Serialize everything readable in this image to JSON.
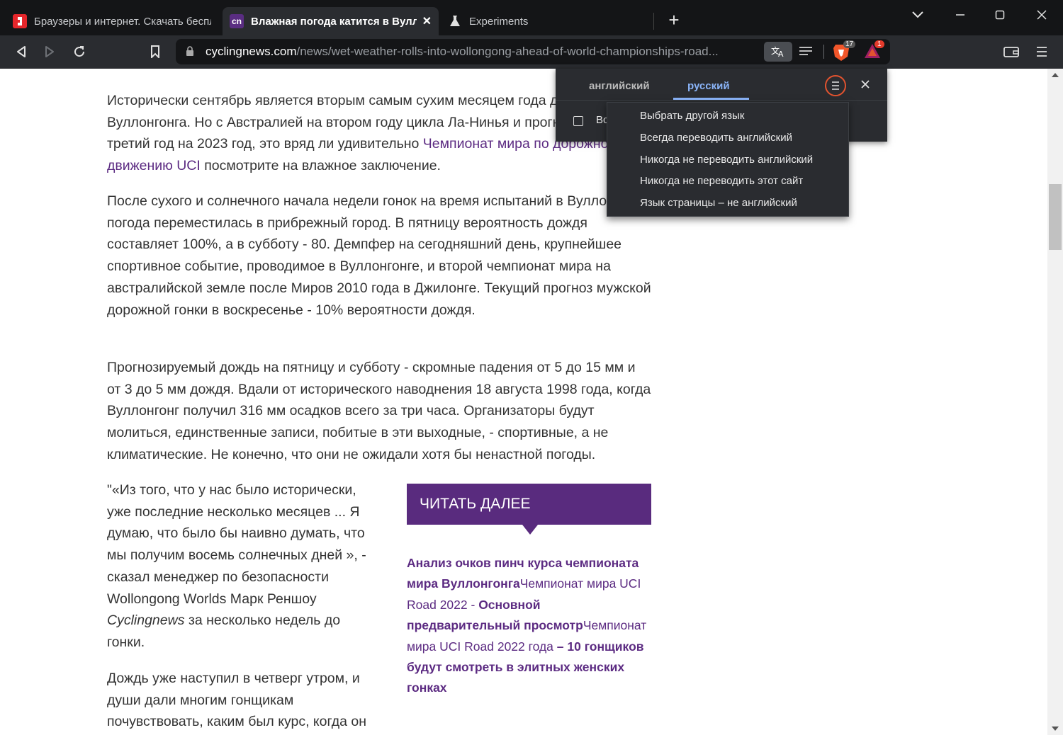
{
  "tabs": [
    {
      "title": "Браузеры и интернет. Скачать беспл",
      "favicon": "red-square-icon"
    },
    {
      "title": "Влажная погода катится в Вуллонгонг",
      "favicon": "cn"
    },
    {
      "title": "Experiments",
      "favicon": "flask-icon"
    }
  ],
  "address_bar": {
    "host": "cyclingnews.com",
    "path": "/news/wet-weather-rolls-into-wollongong-ahead-of-world-championships-road..."
  },
  "badges": {
    "brave_shields": "17",
    "rewards": "1"
  },
  "article": {
    "p1": {
      "text": "Исторически сентябрь является вторым самым сухим месяцем года для Вуллонгонга. Но с Австралией на втором году цикла Ла-Нинья и прогнозом на третий год на 2023 год, это вряд ли удивительно ",
      "link": "Чемпионат мира по дорожному движению UCI",
      "tail": " посмотрите на влажное заключение."
    },
    "p2": "После сухого и солнечного начала недели гонок на время испытаний в Вуллонгонге погода переместилась в прибрежный город. В пятницу вероятность дождя составляет 100%, а в субботу - 80. Демпфер на сегодняшний день, крупнейшее спортивное событие, проводимое в Вуллонгонге, и второй чемпионат мира на австралийской земле после Миров 2010 года в Джилонге. Текущий прогноз мужской дорожной гонки в воскресенье - 10% вероятности дождя.",
    "p3": "Прогнозируемый дождь на пятницу и субботу - скромные падения от 5 до 15 мм и от 3 до 5 мм дождя. Вдали от исторического наводнения 18 августа 1998 года, когда Вуллонгонг получил 316 мм осадков всего за три часа. Организаторы будут молиться, единственные записи, побитые в эти выходные, - спортивные, а не климатические. Не конечно, что они не ожидали хотя бы ненастной погоды.",
    "p4": {
      "text": "\"«Из того, что у нас было исторически, уже последние несколько месяцев ... Я думаю, что было бы наивно думать, что мы получим восемь солнечных дней », - сказал менеджер по безопасности Wollongong Worlds Марк Реншоу ",
      "italic": "Cyclingnews",
      "tail": " за несколько недель до гонки."
    },
    "p5": "Дождь уже наступил в четверг утром, и души дали многим гонщикам почувствовать, каким был курс, когда он"
  },
  "read_more": {
    "heading": "ЧИТАТЬ ДАЛЕЕ",
    "l1": "Анализ очков пинч курса чемпионата мира Вуллонгонга",
    "l2": "Чемпионат мира UCI Road 2022 - ",
    "l3": "Основной предварительный просмотр",
    "l4": "Чемпионат мира UCI Road 2022 года",
    "l5": " – 10 гонщиков будут смотреть в элитных женских гонках"
  },
  "translate_popup": {
    "source_lang": "английский",
    "target_lang": "русский",
    "checkbox_label": "Всегда переводить английский",
    "menu": [
      "Выбрать другой язык",
      "Всегда переводить английский",
      "Никогда не переводить английский",
      "Никогда не переводить этот сайт",
      "Язык страницы – не английский"
    ]
  }
}
